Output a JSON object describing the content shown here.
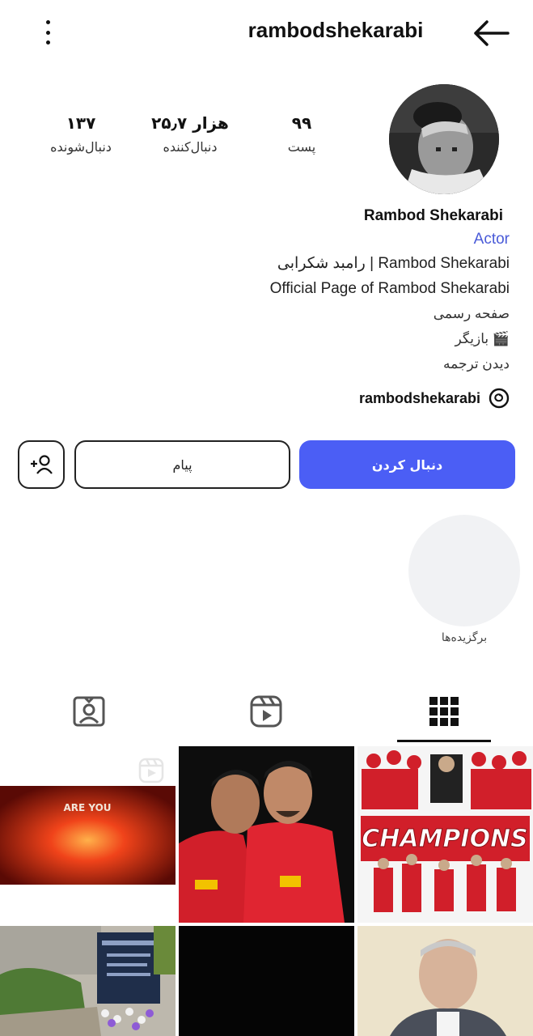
{
  "header": {
    "username": "rambodshekarabi",
    "icons": {
      "menu": "more-vertical-icon",
      "back": "arrow-back-icon"
    }
  },
  "stats": {
    "posts": {
      "value": "۹۹",
      "label": "پست"
    },
    "followers": {
      "value": "۲۵٫۷ هزار",
      "label": "دنبال‌کننده"
    },
    "following": {
      "value": "۱۳۷",
      "label": "دنبال‌شونده"
    }
  },
  "bio": {
    "name": "Rambod Shekarabi",
    "category": "Actor",
    "lines": [
      "رامبد شکرابی | Rambod Shekarabi",
      "Official Page of Rambod Shekarabi",
      "صفحه رسمی",
      "بازیگر 🎬",
      "دیدن ترجمه"
    ],
    "threads_handle": "rambodshekarabi"
  },
  "actions": {
    "follow_label": "دنبال کردن",
    "message_label": "پیام"
  },
  "highlights": [
    {
      "label": "برگزیده‌ها"
    }
  ],
  "tabs": [
    {
      "name": "posts-grid",
      "active": true
    },
    {
      "name": "reels",
      "active": false
    },
    {
      "name": "tagged",
      "active": false
    }
  ],
  "grid_posts": [
    {
      "caption": "CHAMPIONS"
    },
    {
      "caption": ""
    },
    {
      "caption": "ARE YOU"
    },
    {
      "caption": ""
    },
    {
      "caption": ""
    },
    {
      "caption": ""
    }
  ],
  "colors": {
    "accent": "#4b5ef5",
    "category": "#4a5bd8",
    "highlight_bg": "#f1f2f4",
    "team_red": "#d11f2a"
  }
}
